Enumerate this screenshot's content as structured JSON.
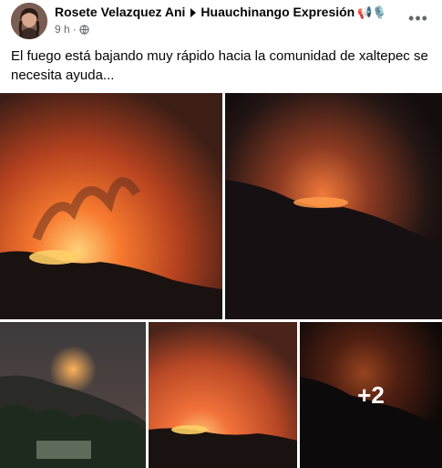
{
  "post": {
    "author": "Rosete Velazquez Ani",
    "group": "Huauchinango Expresión",
    "group_emoji": "📢🎙️",
    "time": "9 h",
    "privacy_icon": "globe-icon",
    "menu_icon": "more-options-icon",
    "caption": "El fuego está bajando muy rápido hacia la comunidad de xaltepec se necesita ayuda...",
    "photos": [
      {
        "name": "photo-1",
        "description": "forest-fire-night"
      },
      {
        "name": "photo-2",
        "description": "forest-fire-night"
      },
      {
        "name": "photo-3",
        "description": "forest-fire-night"
      },
      {
        "name": "photo-4",
        "description": "forest-fire-night"
      },
      {
        "name": "photo-5",
        "description": "forest-fire-night"
      }
    ],
    "more_photos_label": "+2"
  },
  "colors": {
    "text_primary": "#050505",
    "text_secondary": "#65676b",
    "fire_glow": "#f26a2e",
    "night_sky": "#1a1210"
  }
}
